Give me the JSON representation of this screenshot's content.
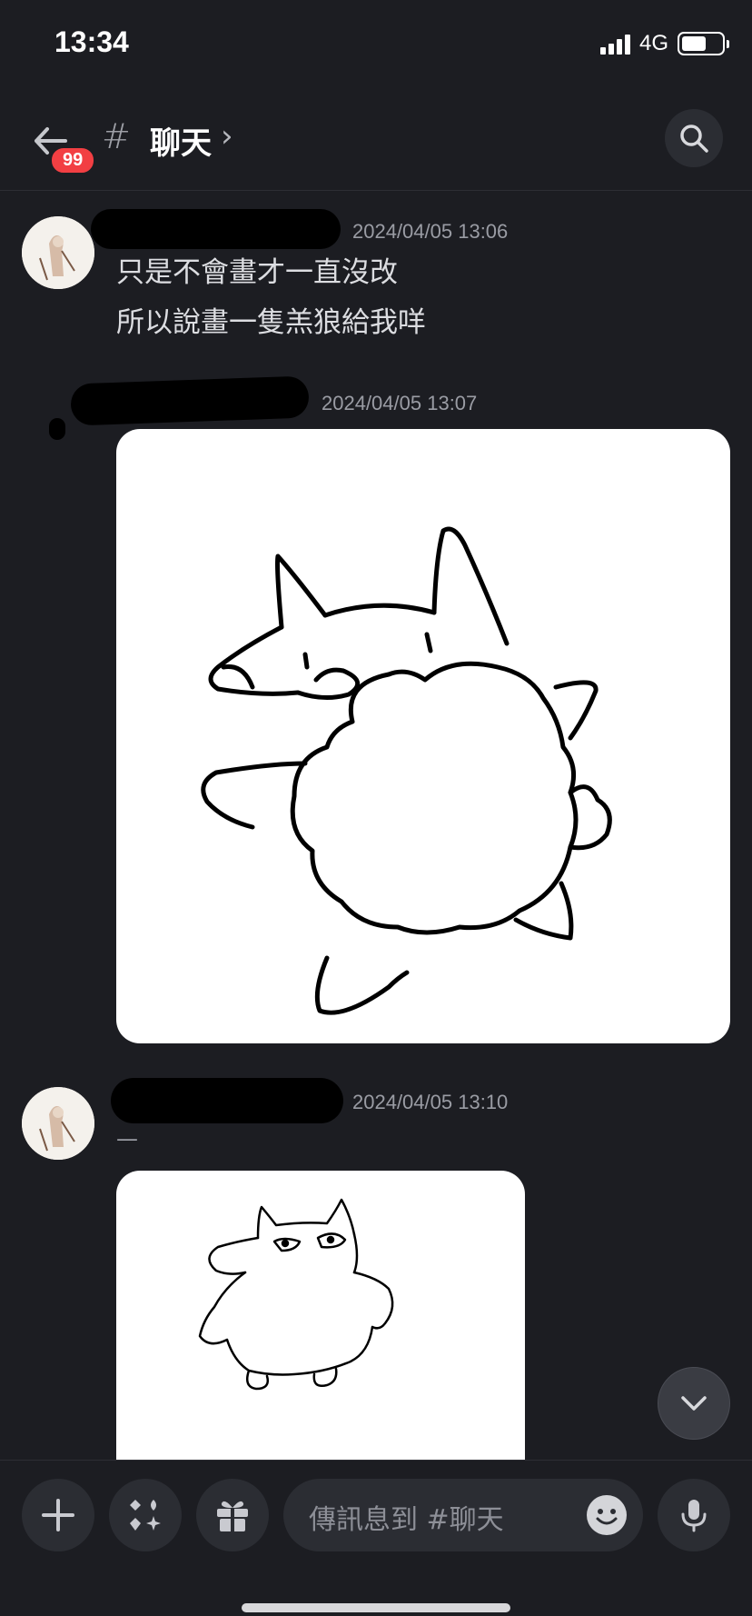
{
  "status_bar": {
    "time": "13:34",
    "network": "4G",
    "battery_level": 0.62
  },
  "header": {
    "unread_badge": "99",
    "channel_hash": "#",
    "channel_name": "聊天",
    "chevron": "›",
    "back_icon": "arrow-left-icon",
    "search_icon": "search-icon"
  },
  "messages": [
    {
      "timestamp": "2024/04/05 13:06",
      "lines": [
        "只是不會畫才一直沒改",
        "所以說畫一隻羔狼給我咩"
      ]
    },
    {
      "timestamp": "2024/04/05 13:07",
      "image": "drawing of a wolf holding a large fluffy cloud shape"
    },
    {
      "timestamp": "2024/04/05 13:10",
      "lines": [
        "—"
      ],
      "image": "rough doodle of a grumpy fox creature"
    }
  ],
  "composer": {
    "placeholder": "傳訊息到 #聊天",
    "buttons": [
      "plus-icon",
      "apps-icon",
      "gift-icon",
      "emoji-icon",
      "microphone-icon"
    ]
  },
  "scroll_down_icon": "chevron-down-icon"
}
